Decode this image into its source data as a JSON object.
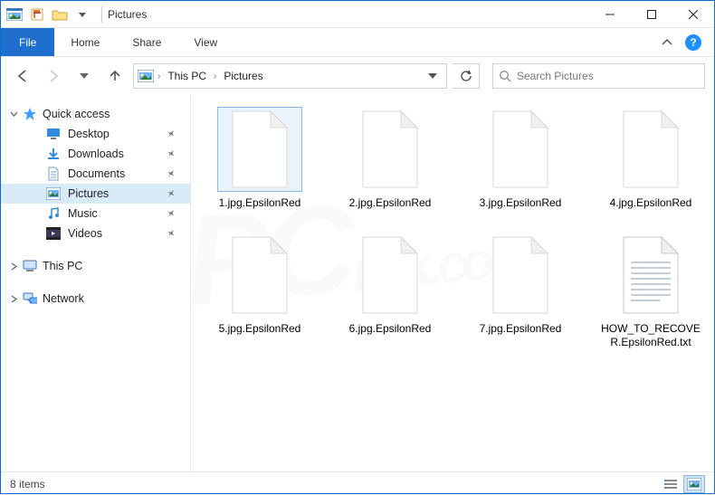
{
  "titlebar": {
    "title": "Pictures"
  },
  "ribbon": {
    "file": "File",
    "tabs": [
      "Home",
      "Share",
      "View"
    ]
  },
  "breadcrumb": {
    "root": "This PC",
    "current": "Pictures"
  },
  "search": {
    "placeholder": "Search Pictures"
  },
  "sidebar": {
    "quick_access": "Quick access",
    "quick_items": [
      {
        "label": "Desktop",
        "icon": "desktop"
      },
      {
        "label": "Downloads",
        "icon": "downloads"
      },
      {
        "label": "Documents",
        "icon": "documents"
      },
      {
        "label": "Pictures",
        "icon": "pictures",
        "selected": true
      },
      {
        "label": "Music",
        "icon": "music"
      },
      {
        "label": "Videos",
        "icon": "videos"
      }
    ],
    "this_pc": "This PC",
    "network": "Network"
  },
  "files": [
    {
      "name": "1.jpg.EpsilonRed",
      "type": "blank",
      "selected": true
    },
    {
      "name": "2.jpg.EpsilonRed",
      "type": "blank"
    },
    {
      "name": "3.jpg.EpsilonRed",
      "type": "blank"
    },
    {
      "name": "4.jpg.EpsilonRed",
      "type": "blank"
    },
    {
      "name": "5.jpg.EpsilonRed",
      "type": "blank"
    },
    {
      "name": "6.jpg.EpsilonRed",
      "type": "blank"
    },
    {
      "name": "7.jpg.EpsilonRed",
      "type": "blank"
    },
    {
      "name": "HOW_TO_RECOVER.EpsilonRed.txt",
      "type": "text"
    }
  ],
  "status": {
    "count_label": "8 items"
  }
}
